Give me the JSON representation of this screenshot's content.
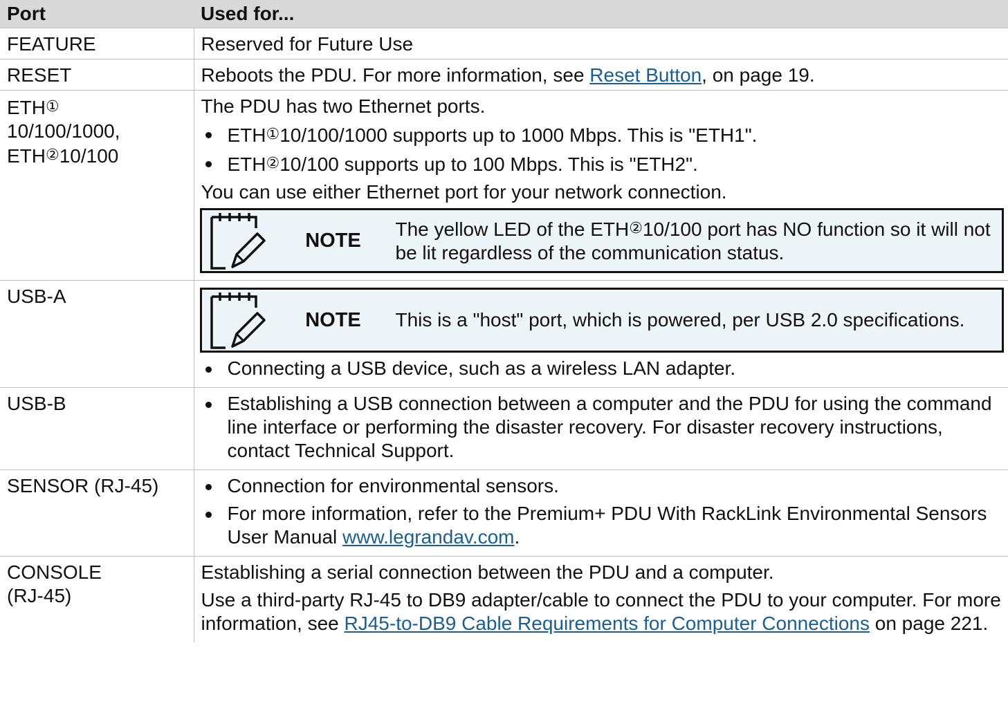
{
  "header": {
    "port": "Port",
    "used_for": "Used for..."
  },
  "rows": {
    "feature": {
      "port": "FEATURE",
      "text": "Reserved for Future Use"
    },
    "reset": {
      "port": "RESET",
      "text_before": "Reboots the PDU. For more information, see ",
      "link": "Reset Button",
      "text_after": ", on page 19."
    },
    "eth": {
      "port_line1_prefix": "ETH",
      "port_line1_symbol": "①",
      "port_line2": "10/100/1000,",
      "port_line3_prefix": "ETH",
      "port_line3_symbol": "②",
      "port_line3_suffix": "10/100",
      "intro": "The PDU has two Ethernet ports.",
      "bullets": [
        {
          "prefix": "ETH",
          "symbol": "①",
          "text": "10/100/1000 supports up to 1000 Mbps. This is \"ETH1\"."
        },
        {
          "prefix": "ETH",
          "symbol": "②",
          "text": "10/100 supports up to 100 Mbps. This is \"ETH2\"."
        }
      ],
      "after": "You can use either Ethernet port for your network connection.",
      "note": {
        "label": "NOTE",
        "text_prefix": "The yellow LED of the ETH",
        "symbol": "②",
        "text_suffix": "10/100 port has NO function so it will not be lit regardless of the communication status."
      }
    },
    "usba": {
      "port": "USB-A",
      "note": {
        "label": "NOTE",
        "text": "This is a \"host\" port, which is powered, per USB 2.0 specifications."
      },
      "bullets": [
        "Connecting a USB device, such as a wireless LAN adapter."
      ]
    },
    "usbb": {
      "port": "USB-B",
      "bullets": [
        "Establishing a USB connection between a computer and the PDU for using the command line interface or performing the disaster recovery. For disaster recovery instructions, contact Technical Support."
      ]
    },
    "sensor": {
      "port": "SENSOR (RJ-45)",
      "bullet1": "Connection for environmental sensors.",
      "bullet2_text": "For more information, refer to the Premium+ PDU With RackLink Environmental Sensors User Manual ",
      "bullet2_link": "www.legrandav.com",
      "bullet2_after": "."
    },
    "console": {
      "port_line1": "CONSOLE",
      "port_line2": "(RJ-45)",
      "p1": "Establishing a serial connection between the PDU and a computer.",
      "p2_text": "Use a third-party RJ-45 to DB9 adapter/cable to connect the PDU to your computer. For more information, see ",
      "p2_link": "RJ45-to-DB9 Cable Requirements for Computer Connections",
      "p2_after": " on page 221."
    }
  },
  "icons": {
    "note": "notepad-pencil-icon"
  },
  "colors": {
    "header_bg": "#d9d9d9",
    "note_bg": "#eef5f9",
    "link": "#1a5e96",
    "border": "#bdbdbd"
  }
}
